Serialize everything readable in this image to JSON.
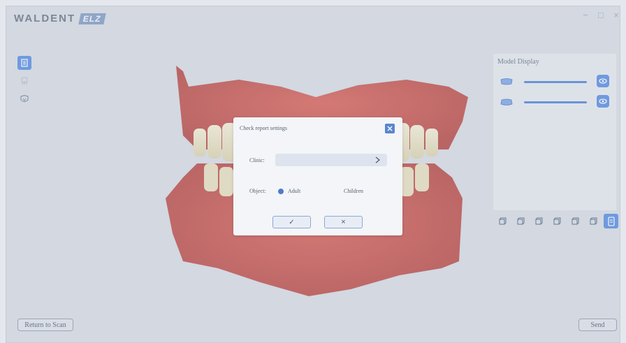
{
  "header": {
    "logo_text": "WALDENT",
    "logo_badge": "ELZ"
  },
  "window_controls": {
    "minimize": "−",
    "maximize": "□",
    "close": "×"
  },
  "left_toolbar": {
    "icons": [
      "report-icon",
      "tooth-icon",
      "shield-tooth-icon"
    ],
    "active_index": 0
  },
  "model_display": {
    "title": "Model Display",
    "rows": [
      {
        "icon": "upper-jaw-icon",
        "level": 1.0,
        "visible_icon": "eye-icon"
      },
      {
        "icon": "lower-jaw-icon",
        "level": 1.0,
        "visible_icon": "eye-icon"
      }
    ]
  },
  "view_buttons": {
    "icons": [
      "view-front-icon",
      "view-back-icon",
      "view-left-icon",
      "view-right-icon",
      "view-top-icon",
      "view-bottom-icon",
      "view-occlusal-icon"
    ],
    "active_index": 6
  },
  "dialog": {
    "title": "Check report settings",
    "clinic_label": "Clinic:",
    "clinic_value": "",
    "object_label": "Object:",
    "options": [
      {
        "label": "Adult",
        "selected": true
      },
      {
        "label": "Children",
        "selected": false
      }
    ],
    "confirm_glyph": "✓",
    "cancel_glyph": "×"
  },
  "footer": {
    "return_label": "Return to Scan",
    "send_label": "Send"
  },
  "colors": {
    "accent": "#6f9ade",
    "background": "#d3d8e1",
    "gum": "#c8463f"
  }
}
